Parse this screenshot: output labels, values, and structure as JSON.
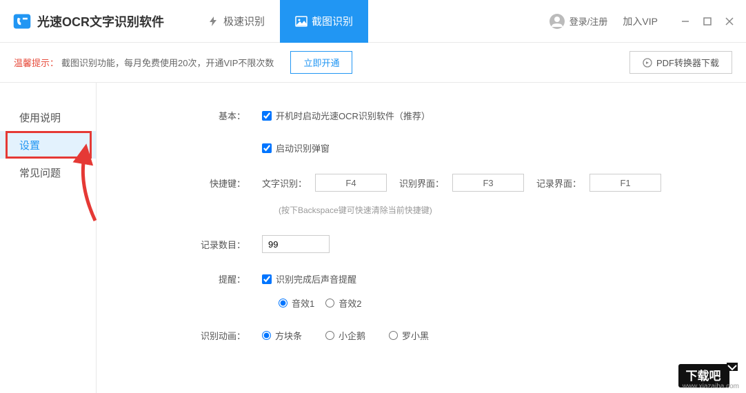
{
  "app": {
    "title": "光速OCR文字识别软件"
  },
  "tabs": {
    "speed": "极速识别",
    "screenshot": "截图识别"
  },
  "header": {
    "login": "登录/注册",
    "vip": "加入VIP"
  },
  "banner": {
    "tip": "温馨提示：",
    "text": "截图识别功能，每月免费使用20次，开通VIP不限次数",
    "open_btn": "立即开通",
    "pdf_btn": "PDF转换器下载"
  },
  "sidebar": {
    "instructions": "使用说明",
    "settings": "设置",
    "faq": "常见问题"
  },
  "settings": {
    "basic_label": "基本：",
    "autostart": "开机时启动光速OCR识别软件（推荐）",
    "popup": "启动识别弹窗",
    "shortcut_label": "快捷键：",
    "sc_text_label": "文字识别：",
    "sc_text_val": "F4",
    "sc_ui_label": "识别界面：",
    "sc_ui_val": "F3",
    "sc_record_label": "记录界面：",
    "sc_record_val": "F1",
    "shortcut_hint": "(按下Backspace键可快速清除当前快捷键)",
    "records_label": "记录数目：",
    "records_val": "99",
    "notify_label": "提醒：",
    "notify_check": "识别完成后声音提醒",
    "sound1": "音效1",
    "sound2": "音效2",
    "anim_label": "识别动画：",
    "anim1": "方块条",
    "anim2": "小企鹅",
    "anim3": "罗小黑"
  },
  "watermark": {
    "site_text": "www.xiazaiba.com",
    "brand": "下载吧"
  }
}
